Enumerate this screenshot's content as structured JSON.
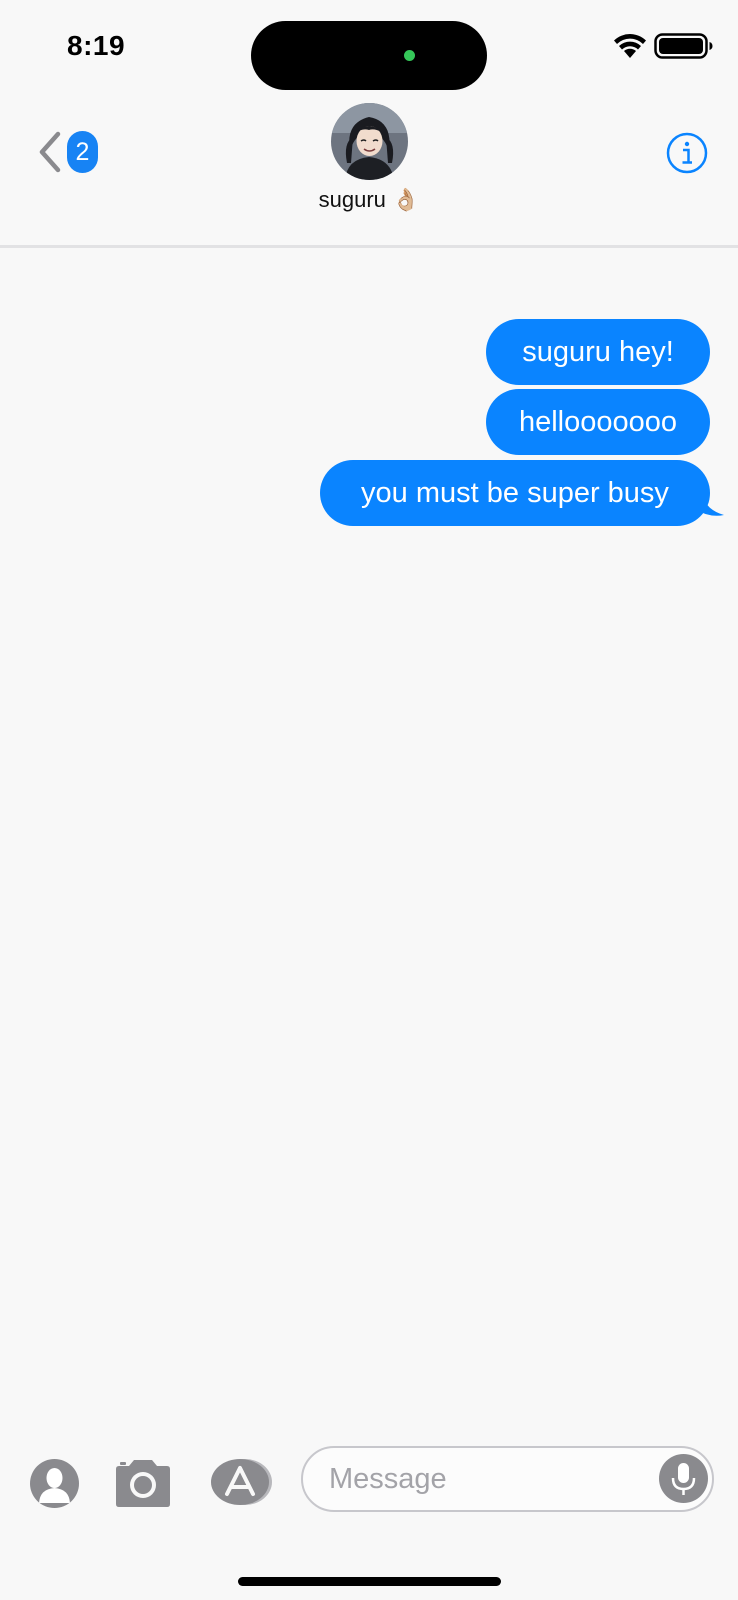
{
  "status_bar": {
    "time": "8:19",
    "icons": [
      "wifi-icon",
      "battery-icon"
    ]
  },
  "header": {
    "back_badge_count": "2",
    "contact_name": "suguru 👌🏼",
    "avatar_icon": "contact-avatar-photo",
    "info_icon": "info-icon"
  },
  "messages": [
    {
      "text": "suguru hey!",
      "direction": "outgoing"
    },
    {
      "text": "hellooooooo",
      "direction": "outgoing"
    },
    {
      "text": "you must be super busy",
      "direction": "outgoing"
    }
  ],
  "composer": {
    "placeholder": "Message",
    "value": "",
    "icons": [
      "contact-icon",
      "camera-icon",
      "app-store-icon",
      "microphone-icon"
    ]
  },
  "colors": {
    "accent": "#0a84ff",
    "badge": "#1783f4",
    "background": "#f8f8f8",
    "icon_gray": "#8a8a8e"
  }
}
